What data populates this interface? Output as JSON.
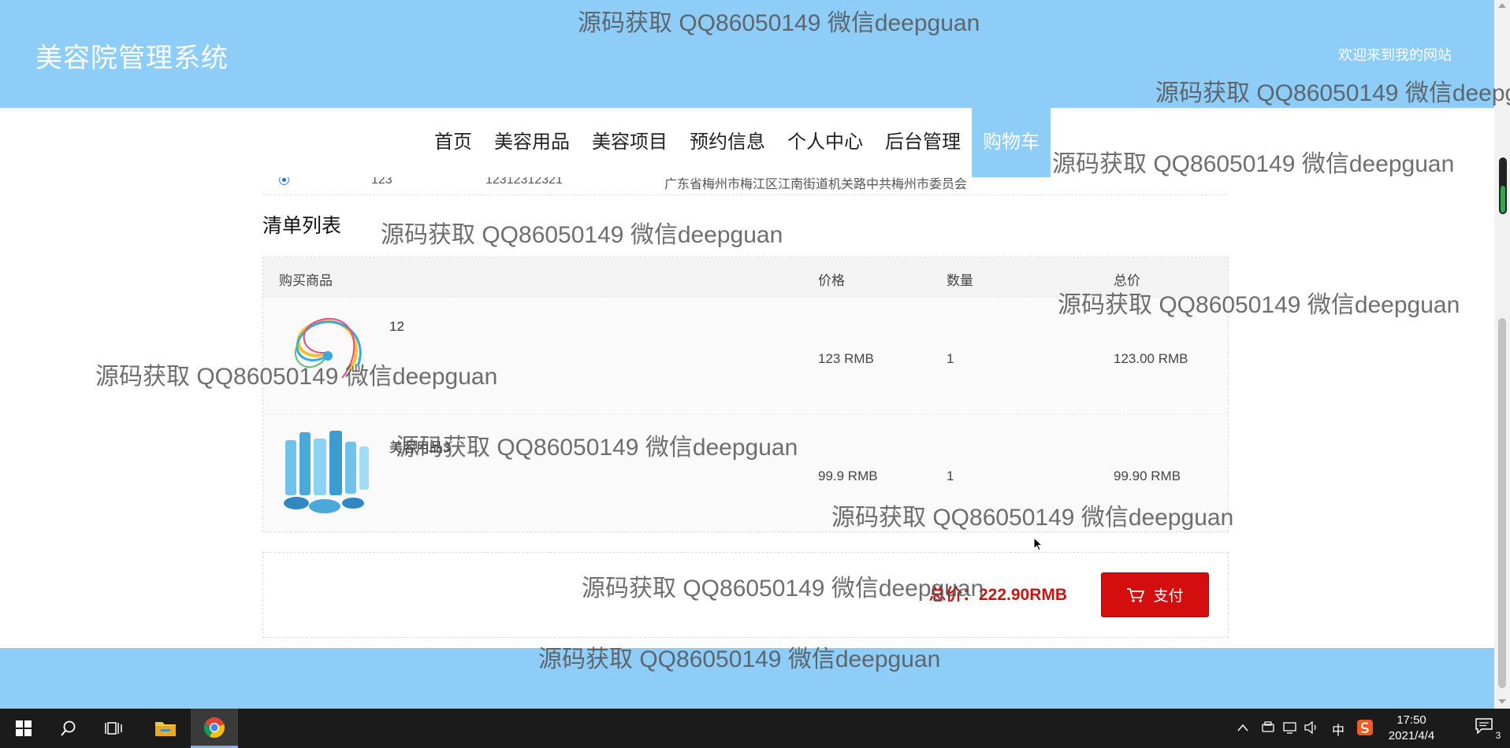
{
  "site": {
    "title": "美容院管理系统",
    "welcome": "欢迎来到我的网站"
  },
  "nav": {
    "items": [
      "首页",
      "美容用品",
      "美容项目",
      "预约信息",
      "个人中心",
      "后台管理",
      "购物车"
    ],
    "active_index": 6
  },
  "address_row": {
    "name": "123",
    "phone": "12312312321",
    "address": "广东省梅州市梅江区江南街道机关路中共梅州市委员会"
  },
  "list": {
    "title": "清单列表",
    "columns": [
      "购买商品",
      "价格",
      "数量",
      "总价"
    ],
    "rows": [
      {
        "name": "12",
        "price": "123 RMB",
        "qty": "1",
        "total": "123.00 RMB",
        "image": "swirl-logo-image"
      },
      {
        "name": "美容用品3",
        "price": "99.9 RMB",
        "qty": "1",
        "total": "99.90 RMB",
        "image": "skincare-bottles-image"
      }
    ]
  },
  "summary": {
    "total_label": "总价：222.90RMB",
    "pay_label": "支付"
  },
  "watermark": "源码获取 QQ86050149 微信deepguan",
  "taskbar": {
    "ime": "中",
    "time": "17:50",
    "date": "2021/4/4",
    "notification_count": "3"
  },
  "colors": {
    "header_bg": "#8ecdf8",
    "pay_button": "#d40e0e",
    "total_text": "#c81414"
  }
}
